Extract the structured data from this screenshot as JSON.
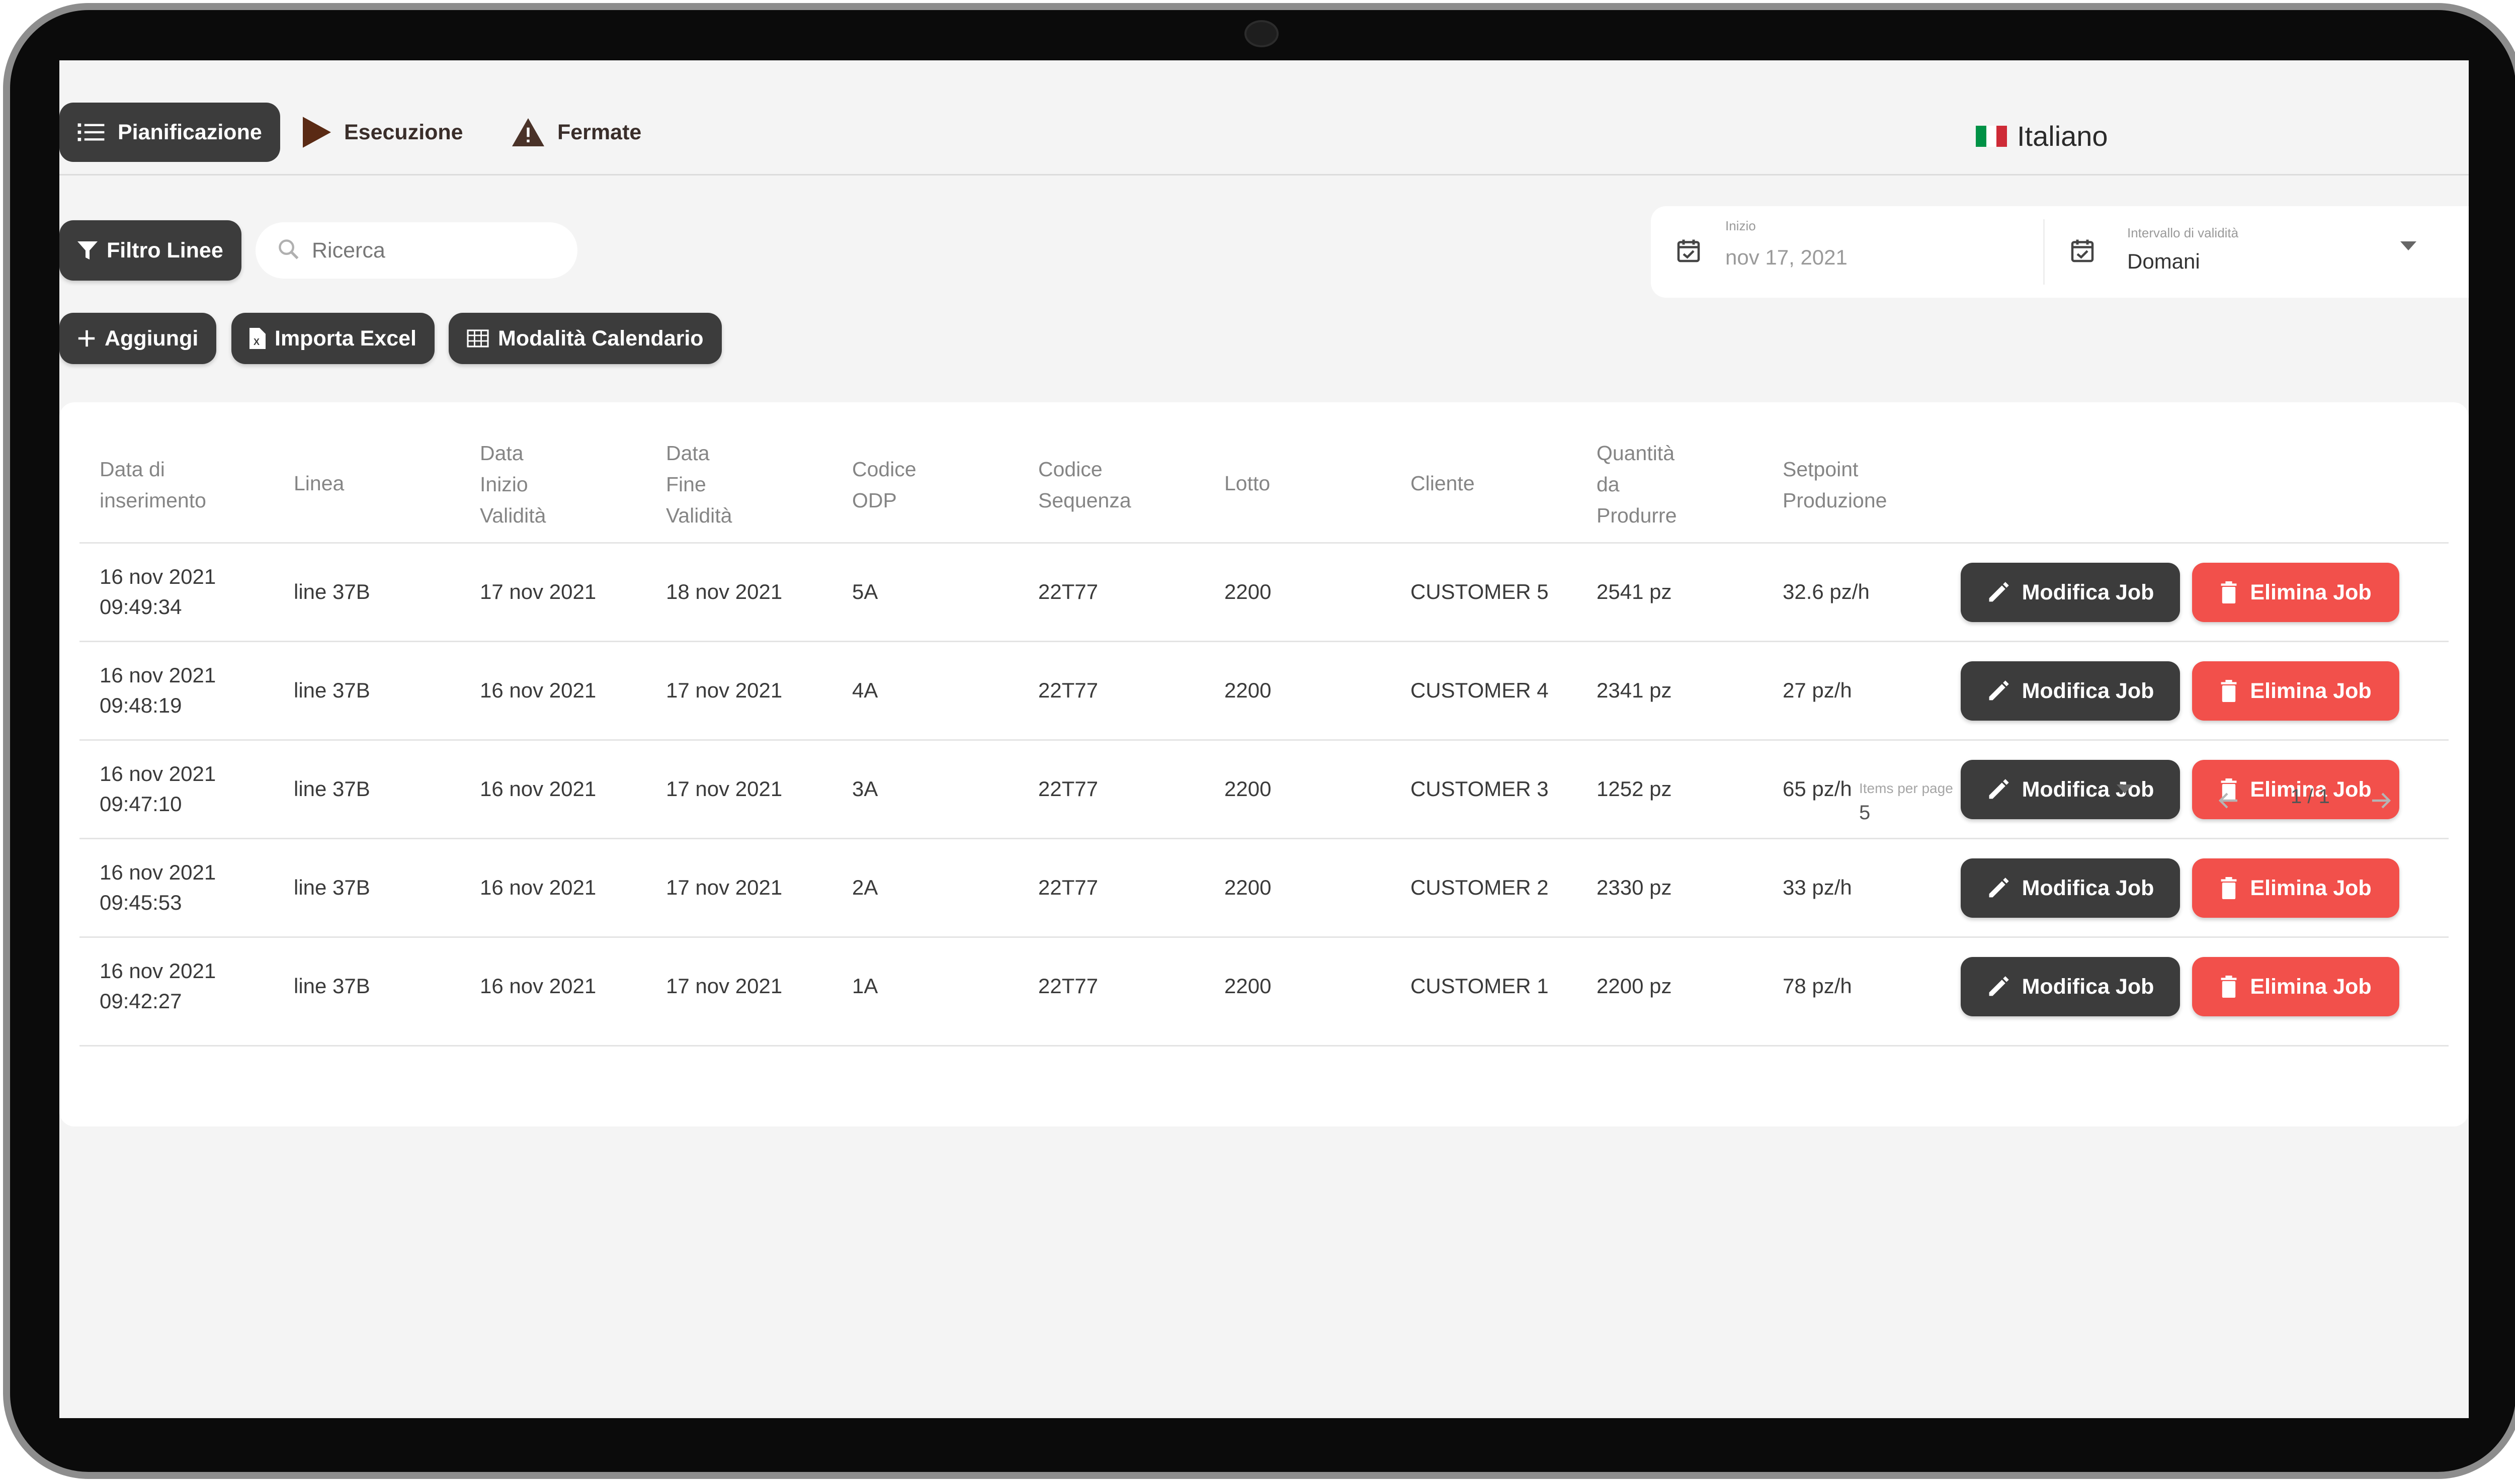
{
  "nav": {
    "items": [
      {
        "label": "Pianificazione",
        "active": true,
        "icon": "list-icon"
      },
      {
        "label": "Esecuzione",
        "active": false,
        "icon": "play-icon"
      },
      {
        "label": "Fermate",
        "active": false,
        "icon": "warning-icon"
      }
    ],
    "language": "Italiano",
    "flag_colors": [
      "#009246",
      "#ffffff",
      "#ce2b37"
    ]
  },
  "toolbar": {
    "filter_label": "Filtro Linee",
    "search_placeholder": "Ricerca",
    "add_label": "Aggiungi",
    "import_label": "Importa Excel",
    "calendar_label": "Modalità Calendario"
  },
  "date_filter": {
    "start_label": "Inizio",
    "start_value": "nov 17, 2021",
    "range_label": "Intervallo di validità",
    "range_value": "Domani"
  },
  "table": {
    "columns": [
      "Data di\ninserimento",
      "Linea",
      "Data\nInizio\nValidità",
      "Data\nFine\nValidità",
      "Codice\nODP",
      "Codice\nSequenza",
      "Lotto",
      "Cliente",
      "Quantità\nda\nProdurre",
      "Setpoint\nProduzione"
    ],
    "rows": [
      {
        "inserted": "16 nov 2021\n09:49:34",
        "line": "line 37B",
        "start": "17 nov 2021",
        "end": "18 nov 2021",
        "odp": "5A",
        "sequence": "22T77",
        "lot": "2200",
        "customer": "CUSTOMER 5",
        "quantity": "2541  pz",
        "setpoint": "32.6  pz/h"
      },
      {
        "inserted": "16 nov 2021\n09:48:19",
        "line": "line 37B",
        "start": "16 nov 2021",
        "end": "17 nov 2021",
        "odp": "4A",
        "sequence": "22T77",
        "lot": "2200",
        "customer": "CUSTOMER 4",
        "quantity": "2341  pz",
        "setpoint": "27  pz/h"
      },
      {
        "inserted": "16 nov 2021\n09:47:10",
        "line": "line 37B",
        "start": "16 nov 2021",
        "end": "17 nov 2021",
        "odp": "3A",
        "sequence": "22T77",
        "lot": "2200",
        "customer": "CUSTOMER 3",
        "quantity": "1252  pz",
        "setpoint": "65  pz/h"
      },
      {
        "inserted": "16 nov 2021\n09:45:53",
        "line": "line 37B",
        "start": "16 nov 2021",
        "end": "17 nov 2021",
        "odp": "2A",
        "sequence": "22T77",
        "lot": "2200",
        "customer": "CUSTOMER 2",
        "quantity": "2330  pz",
        "setpoint": "33  pz/h"
      },
      {
        "inserted": "16 nov 2021\n09:42:27",
        "line": "line 37B",
        "start": "16 nov 2021",
        "end": "17 nov 2021",
        "odp": "1A",
        "sequence": "22T77",
        "lot": "2200",
        "customer": "CUSTOMER 1",
        "quantity": "2200  pz",
        "setpoint": "78  pz/h"
      }
    ],
    "edit_label": "Modifica Job",
    "delete_label": "Elimina Job"
  },
  "pagination": {
    "items_per_page_label": "Items per page",
    "items_per_page_value": "5",
    "page_info": "1 / 1"
  }
}
